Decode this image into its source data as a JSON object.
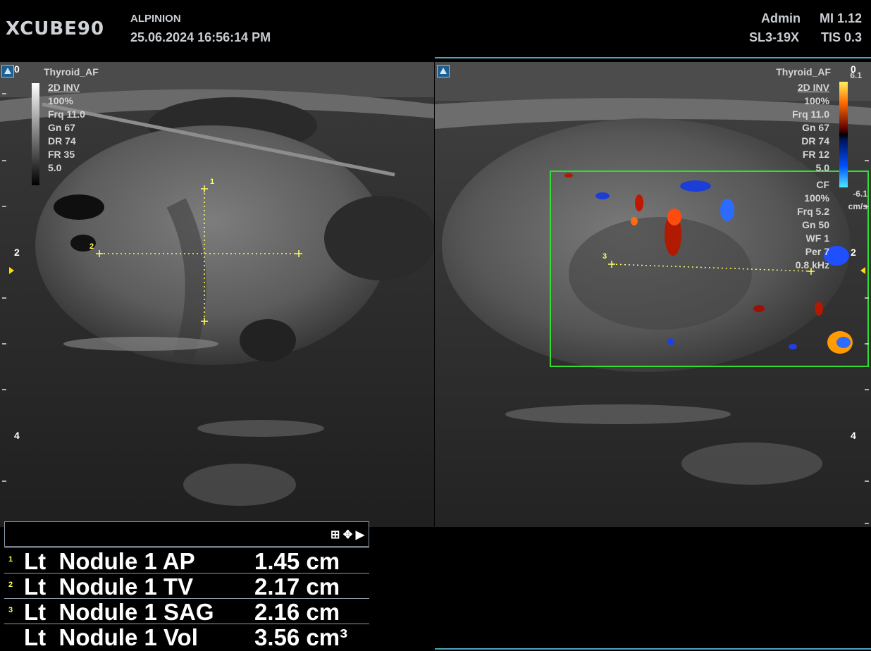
{
  "header": {
    "logo": "XCUBE90",
    "manufacturer": "ALPINION",
    "datetime": "25.06.2024  16:56:14 PM",
    "user": "Admin",
    "mi": "MI 1.12",
    "probe": "SL3-19X",
    "tis": "TIS 0.3"
  },
  "left_panel": {
    "preset": "Thyroid_AF",
    "params": [
      "2D INV",
      "100%",
      "Frq 11.0",
      "Gn 67",
      "DR 74",
      "FR 35",
      "5.0"
    ],
    "depth_ticks": [
      "0",
      "2",
      "4"
    ],
    "caliper_labels": [
      "1",
      "2"
    ]
  },
  "right_panel": {
    "preset": "Thyroid_AF",
    "params": [
      "2D INV",
      "100%",
      "Frq 11.0",
      "Gn 67",
      "DR 74",
      "FR 12",
      "5.0"
    ],
    "cf_params": [
      "CF",
      "100%",
      "Frq 5.2",
      "Gn 50",
      "WF 1",
      "Per 7",
      "0.8 kHz"
    ],
    "scale_max": "6.1",
    "scale_min": "-6.1",
    "scale_unit": "cm/s",
    "depth_ticks": [
      "0",
      "2",
      "4"
    ],
    "caliper_labels": [
      "3"
    ]
  },
  "measurements": {
    "rows": [
      {
        "num": "1",
        "label": "Lt  Nodule 1 AP",
        "value": "1.45 cm"
      },
      {
        "num": "2",
        "label": "Lt  Nodule 1 TV",
        "value": "2.17 cm"
      },
      {
        "num": "3",
        "label": "Lt  Nodule 1 SAG",
        "value": "2.16 cm"
      },
      {
        "num": "",
        "label": "Lt  Nodule 1 Vol",
        "value": "3.56 cm³"
      }
    ],
    "icons": [
      "grid-icon",
      "move-icon",
      "expand-arrow-icon"
    ]
  },
  "colors": {
    "caliper": "#ffff66",
    "cf_box": "#33dd33"
  }
}
